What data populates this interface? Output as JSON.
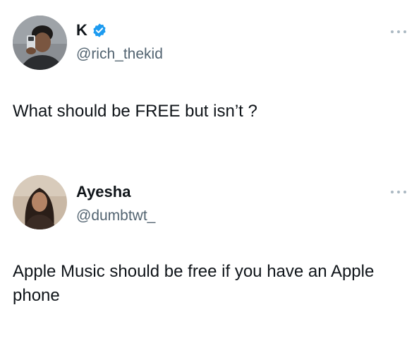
{
  "tweets": [
    {
      "display_name": "K",
      "verified": true,
      "handle": "@rich_thekid",
      "text": "What should be FREE but isn’t ?",
      "avatar_icon": "avatar-photo-man-selfie",
      "more_icon": "more-options-icon"
    },
    {
      "display_name": "Ayesha",
      "verified": false,
      "handle": "@dumbtwt_",
      "text": "Apple Music should be free if you have an Apple phone",
      "avatar_icon": "avatar-photo-woman",
      "more_icon": "more-options-icon"
    }
  ],
  "colors": {
    "text_primary": "#0f1419",
    "text_secondary": "#536471",
    "verified_blue": "#1d9bf0",
    "more_dots": "#aab8c2"
  }
}
